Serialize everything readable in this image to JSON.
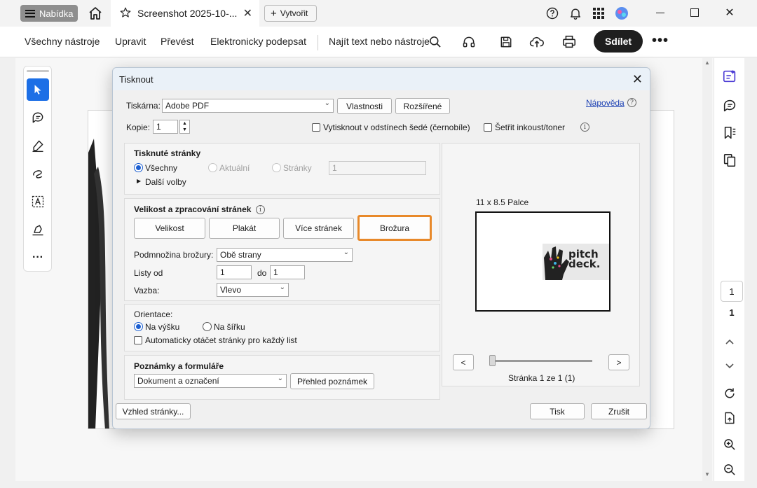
{
  "titlebar": {
    "menu_label": "Nabídka",
    "tab_title": "Screenshot 2025-10-...",
    "new_tab_label": "Vytvořit"
  },
  "toolbar": {
    "all_tools": "Všechny nástroje",
    "edit": "Upravit",
    "convert": "Převést",
    "sign": "Elektronicky podepsat",
    "find": "Najít text nebo nástroje",
    "share": "Sdílet"
  },
  "right_rail": {
    "page_current": "1",
    "page_total": "1"
  },
  "dialog": {
    "title": "Tisknout",
    "printer_label": "Tiskárna:",
    "printer_value": "Adobe PDF",
    "properties_button": "Vlastnosti",
    "advanced_button": "Rozšířené",
    "help_link": "Nápověda",
    "copies_label": "Kopie:",
    "copies_value": "1",
    "grayscale_label": "Vytisknout v odstínech šedé (černobíle)",
    "save_ink_label": "Šetřit inkoust/toner",
    "pages_group": {
      "title": "Tisknuté stránky",
      "all": "Všechny",
      "current": "Aktuální",
      "pages": "Stránky",
      "pages_value": "1",
      "more_options": "Další volby"
    },
    "sizing_group": {
      "title": "Velikost a zpracování stránek",
      "size_button": "Velikost",
      "poster_button": "Plakát",
      "multiple_button": "Více stránek",
      "booklet_button": "Brožura",
      "subset_label": "Podmnožina brožury:",
      "subset_value": "Obě strany",
      "sheets_label": "Listy od",
      "sheets_from": "1",
      "to_label": "do",
      "sheets_to": "1",
      "binding_label": "Vazba:",
      "binding_value": "Vlevo"
    },
    "orientation_group": {
      "title": "Orientace:",
      "portrait": "Na výšku",
      "landscape": "Na šířku",
      "auto_rotate": "Automaticky otáčet stránky pro každý list"
    },
    "comments_group": {
      "title": "Poznámky a formuláře",
      "value": "Dokument a označení",
      "summary_button": "Přehled poznámek"
    },
    "preview": {
      "size_label": "11 x 8.5 Palce",
      "prev": "<",
      "next": ">",
      "page_label": "Stránka 1 ze 1 (1)",
      "logo_line1": "pitch",
      "logo_line2": "deck."
    },
    "page_setup_button": "Vzhled stránky...",
    "print_button": "Tisk",
    "cancel_button": "Zrušit"
  },
  "colors": {
    "accent": "#1c6fe6",
    "highlight": "#e8892a",
    "share_bg": "#1e1e1e"
  }
}
